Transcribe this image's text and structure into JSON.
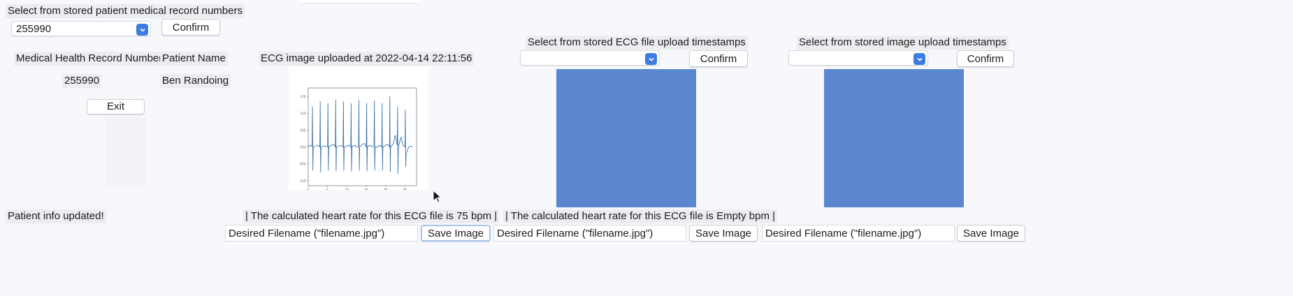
{
  "patient_select": {
    "label": "Select from stored patient medical record numbers",
    "selected": "255990",
    "confirm": "Confirm"
  },
  "info": {
    "mrn_header": "Medical Health Record Number",
    "name_header": "Patient Name",
    "mrn_value": "255990",
    "name_value": "Ben Randoing",
    "exit": "Exit",
    "status": "Patient info updated!"
  },
  "ecg_upload": {
    "title": "ECG image uploaded at 2022-04-14 22:11:56",
    "heart_rate": "| The calculated heart rate for this ECG file is 75 bpm |",
    "filename_value": "Desired Filename (\"filename.jpg\")",
    "save": "Save Image"
  },
  "ecg_timestamps": {
    "label": "Select from stored ECG file upload timestamps",
    "selected": "",
    "confirm": "Confirm",
    "heart_rate": "| The calculated heart rate for this ECG file is Empty bpm |",
    "filename_value": "Desired Filename (\"filename.jpg\")",
    "save": "Save Image"
  },
  "image_timestamps": {
    "label": "Select from stored image upload timestamps",
    "selected": "",
    "confirm": "Confirm",
    "filename_value": "Desired Filename (\"filename.jpg\")",
    "save": "Save Image"
  },
  "colors": {
    "placeholder_panel": "#5b87cf",
    "ecg_line": "#3f77ae",
    "select_arrow": "#3d7de2"
  },
  "icons": {
    "dropdown": "chevron-down-icon",
    "cursor": "mouse-pointer-icon"
  },
  "chart_data": {
    "type": "line",
    "x_ticks": [
      "0",
      "5",
      "10",
      "15",
      "20",
      "25"
    ],
    "y_ticks": [
      "1.5",
      "1.0",
      "0.5",
      "0.0",
      "-0.5",
      "-1.0"
    ],
    "xlim": [
      0,
      28
    ],
    "ylim": [
      -1.15,
      1.75
    ],
    "series": [
      {
        "x": [
          0,
          0.5,
          1,
          1.1,
          1.2,
          1.3,
          2,
          2.5,
          3,
          3.1,
          3.2,
          3.3,
          4,
          4.5,
          5,
          5.1,
          5.2,
          5.3,
          6,
          6.5,
          7,
          7.1,
          7.2,
          7.3,
          8,
          8.5,
          9,
          9.1,
          9.2,
          9.3,
          10,
          10.5,
          11,
          11.1,
          11.2,
          11.3,
          12,
          12.5,
          13,
          13.1,
          13.2,
          13.3,
          14,
          14.5,
          15,
          15.1,
          15.2,
          15.3,
          16,
          16.5,
          17,
          17.1,
          17.2,
          17.3,
          18,
          18.5,
          19,
          19.1,
          19.2,
          19.3,
          20,
          20.5,
          21,
          21.1,
          21.2,
          21.3,
          22,
          22.5,
          23,
          23.1,
          23.2,
          23.3,
          24,
          24.5,
          25,
          25.1,
          25.2,
          25.3,
          26,
          26.5,
          27
        ],
        "y": [
          0.0,
          0.05,
          0.02,
          1.2,
          -0.7,
          0.0,
          0.03,
          0.05,
          0.0,
          1.35,
          -0.75,
          0.0,
          0.04,
          0.0,
          0.02,
          1.3,
          -0.7,
          0.0,
          0.05,
          0.08,
          0.0,
          1.4,
          -0.72,
          0.0,
          0.03,
          0.05,
          0.0,
          1.35,
          -0.7,
          0.0,
          0.02,
          0.06,
          0.0,
          1.3,
          -0.72,
          0.0,
          0.05,
          0.0,
          0.02,
          1.4,
          -0.7,
          0.0,
          0.08,
          0.1,
          0.0,
          1.3,
          -0.72,
          0.0,
          0.05,
          0.0,
          0.03,
          1.38,
          -0.7,
          0.0,
          0.0,
          0.05,
          0.0,
          1.3,
          -0.7,
          0.0,
          0.05,
          0.08,
          0.0,
          1.5,
          -0.75,
          0.0,
          0.1,
          0.35,
          0.05,
          1.2,
          -0.8,
          0.0,
          0.3,
          0.05,
          0.0,
          1.1,
          -0.6,
          -0.2,
          0.0,
          0.02,
          0.0
        ]
      }
    ]
  }
}
